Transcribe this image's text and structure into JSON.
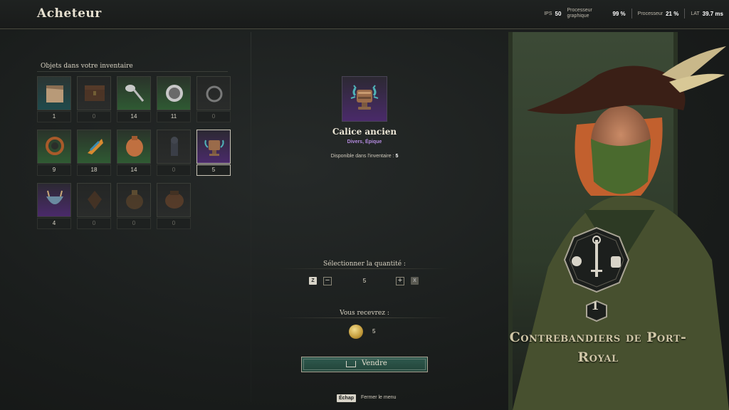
{
  "header": {
    "title": "Acheteur",
    "stats": [
      {
        "label": "IPS",
        "value": "50"
      },
      {
        "label": "Processeur graphique",
        "value": "99 %"
      },
      {
        "label": "Processeur",
        "value": "21 %"
      },
      {
        "label": "LAT",
        "value": "39.7 ms"
      }
    ]
  },
  "inventory": {
    "label": "Objets dans votre inventaire",
    "items": [
      {
        "name": "cloth-item-icon",
        "count": "1",
        "rarity": "teal"
      },
      {
        "name": "chest-item-icon",
        "count": "0",
        "rarity": "dim"
      },
      {
        "name": "spoon-item-icon",
        "count": "14",
        "rarity": "green"
      },
      {
        "name": "coin-item-icon",
        "count": "11",
        "rarity": "green"
      },
      {
        "name": "earring-item-icon",
        "count": "0",
        "rarity": "dim"
      },
      {
        "name": "tooth-necklace-item-icon",
        "count": "9",
        "rarity": "green"
      },
      {
        "name": "feather-fan-item-icon",
        "count": "18",
        "rarity": "green"
      },
      {
        "name": "vase-item-icon",
        "count": "14",
        "rarity": "green"
      },
      {
        "name": "idol-item-icon",
        "count": "0",
        "rarity": "dim"
      },
      {
        "name": "chalice-item-icon",
        "count": "5",
        "rarity": "purple",
        "selected": true
      },
      {
        "name": "antler-bowl-item-icon",
        "count": "4",
        "rarity": "purple"
      },
      {
        "name": "mask-item-icon",
        "count": "0",
        "rarity": "dim"
      },
      {
        "name": "urn-item-icon",
        "count": "0",
        "rarity": "dim"
      },
      {
        "name": "jar-item-icon",
        "count": "0",
        "rarity": "dim"
      }
    ]
  },
  "selected_item": {
    "name": "Calice ancien",
    "rarity": "Divers, Épique",
    "available_label": "Disponible dans l'inventaire :",
    "available_value": "5"
  },
  "quantity": {
    "label": "Sélectionner la quantité :",
    "key_left": "Z",
    "minus": "−",
    "value": "5",
    "plus": "+",
    "key_right": "X"
  },
  "receive": {
    "label": "Vous recevrez :",
    "value": "5"
  },
  "sell_button": {
    "label": "Vendre"
  },
  "footer": {
    "key": "Échap",
    "label": "Fermer le menu"
  },
  "faction": {
    "name": "Contrebandiers de Port-Royal",
    "rank": "1"
  },
  "colors": {
    "accent_green": "#2f5a4f",
    "epic_purple": "#b48bdf"
  }
}
